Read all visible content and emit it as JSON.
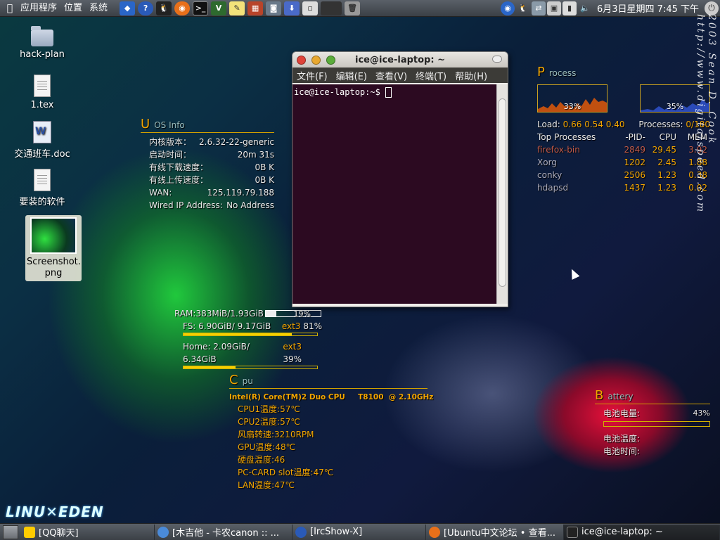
{
  "top_panel": {
    "menus": [
      "应用程序",
      "位置",
      "系统"
    ],
    "launchers": [
      "network-icon",
      "help-icon",
      "qq-icon",
      "firefox-icon",
      "terminal-icon",
      "vim-icon",
      "notes-icon",
      "firewall-icon",
      "screenshot-icon",
      "download-icon",
      "blank1-icon",
      "blank2-icon",
      "trash-icon"
    ],
    "tray": [
      "firefox-tray-icon",
      "qq-tray-icon",
      "network-tray-icon",
      "display-tray-icon",
      "battery-tray-icon",
      "volume-tray-icon"
    ],
    "clock": "6月3日星期四  7:45 下午"
  },
  "desktop_icons": [
    {
      "label": "hack-plan",
      "type": "folder"
    },
    {
      "label": "1.tex",
      "type": "doc"
    },
    {
      "label": "交通班车.doc",
      "type": "word"
    },
    {
      "label": "要装的软件",
      "type": "doc"
    },
    {
      "label": "Screenshot.\npng",
      "type": "image"
    }
  ],
  "terminal": {
    "title": "ice@ice-laptop: ~",
    "menu": [
      "文件(F)",
      "编辑(E)",
      "查看(V)",
      "终端(T)",
      "帮助(H)"
    ],
    "prompt": "ice@ice-laptop:~$ "
  },
  "os_info": {
    "letter": "U",
    "title": "OS Info",
    "rows": [
      {
        "k": "内核版本：",
        "v": "2.6.32-22-generic"
      },
      {
        "k": "启动时间：",
        "v": "20m 31s"
      },
      {
        "k": "有线下载速度：",
        "v": "0B  K"
      },
      {
        "k": "有线上传速度：",
        "v": "0B  K"
      },
      {
        "k": "WAN:",
        "v": "125.119.79.188"
      },
      {
        "k": "Wired IP Address:",
        "v": "No Address"
      }
    ]
  },
  "disk": {
    "ram": {
      "label": "RAM:383MiB/1.93GiB",
      "pct_text": "19%",
      "pct": 19
    },
    "fs": {
      "label": "FS: 6.90GiB/ 9.17GiB",
      "type": "ext3",
      "pct_text": "81%",
      "pct": 81
    },
    "home": {
      "label": "Home: 2.09GiB/ 6.34GiB",
      "type": "ext3",
      "pct_text": "39%",
      "pct": 39
    }
  },
  "cpu": {
    "letter": "C",
    "title": "pu",
    "model": "Intel(R) Core(TM)2 Duo CPU     T8100  @ 2.10GHz",
    "temps": [
      {
        "k": "CPU1温度:",
        "v": "57℃"
      },
      {
        "k": "CPU2温度:",
        "v": "57℃"
      },
      {
        "k": "风扇转速:",
        "v": "3210RPM"
      },
      {
        "k": "GPU温度:",
        "v": "48℃"
      },
      {
        "k": "硬盘温度:",
        "v": "46"
      },
      {
        "k": "PC-CARD slot温度:",
        "v": "47℃"
      },
      {
        "k": "LAN温度:",
        "v": "47℃"
      }
    ]
  },
  "process": {
    "letter": "P",
    "title": "rocess",
    "cpu1_pct": "33%",
    "cpu2_pct": "35%",
    "load_label": "Load:",
    "load": "0.66 0.54 0.40",
    "processes_label": "Processes:",
    "processes": "0/180",
    "headers": [
      "Top Processes",
      "-PID-",
      "CPU",
      "MEM"
    ],
    "rows": [
      {
        "name": "firefox-bin",
        "pid": "2849",
        "cpu": "29.45",
        "mem": "3.92"
      },
      {
        "name": "Xorg",
        "pid": "1202",
        "cpu": "2.45",
        "mem": "1.88"
      },
      {
        "name": "conky",
        "pid": "2506",
        "cpu": "1.23",
        "mem": "0.38"
      },
      {
        "name": "hdapsd",
        "pid": "1437",
        "cpu": "1.23",
        "mem": "0.02"
      }
    ]
  },
  "battery": {
    "letter": "B",
    "title": "attery",
    "charge_label": "电池电量:",
    "charge_text": "43%",
    "charge": 43,
    "temp_label": "电池温度:",
    "time_label": "电池时间:"
  },
  "logo": {
    "a": "LINU",
    "b": "EDEN"
  },
  "watermark": "2003 Sean D. Cook  http://www.digitalspeed.com",
  "taskbar": [
    {
      "label": "[QQ聊天]",
      "active": false
    },
    {
      "label": "[木吉他 - 卡农canon  :: ...",
      "active": false
    },
    {
      "label": "[IrcShow-X]",
      "active": false
    },
    {
      "label": "[Ubuntu中文论坛 • 查看...",
      "active": false
    },
    {
      "label": "ice@ice-laptop: ~",
      "active": true
    }
  ],
  "colors": {
    "accent": "#f2a500",
    "terminal_bg": "#2c0a21",
    "panel": "#4a4f55"
  }
}
